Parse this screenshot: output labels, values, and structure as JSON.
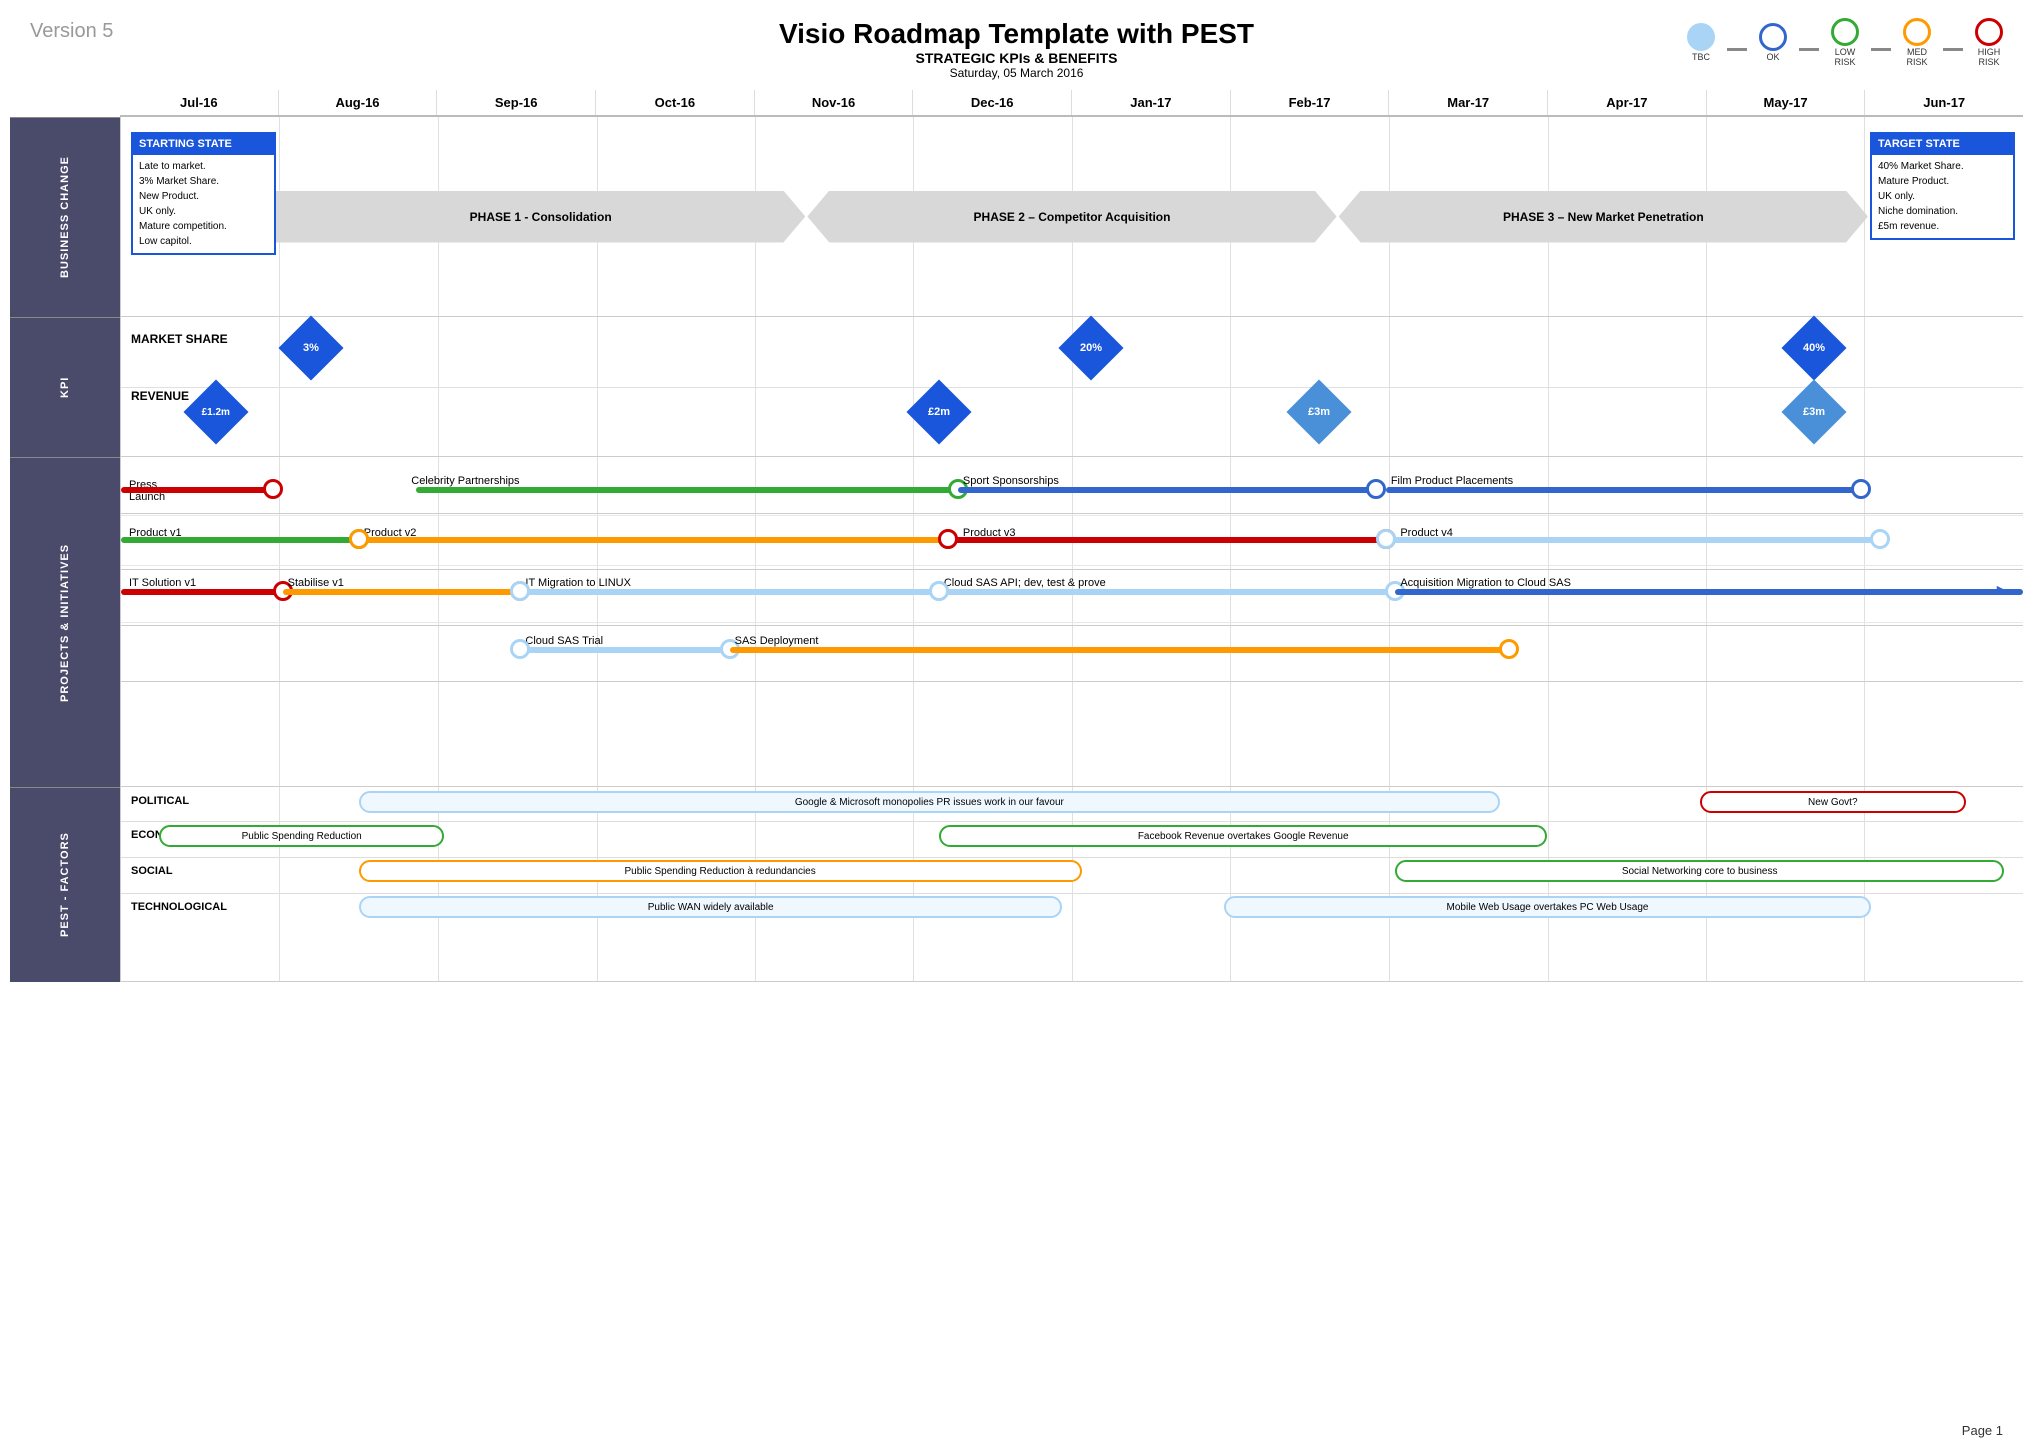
{
  "header": {
    "title": "Visio Roadmap Template with PEST",
    "subtitle": "STRATEGIC KPIs & BENEFITS",
    "date": "Saturday, 05 March 2016",
    "version": "Version 5"
  },
  "legend": {
    "items": [
      {
        "label": "TBC",
        "color": "#aad4f5",
        "border": "#aad4f5"
      },
      {
        "label": "OK",
        "color": "#fff",
        "border": "#3366cc"
      },
      {
        "label": "LOW\nRISK",
        "color": "#fff",
        "border": "#33aa33"
      },
      {
        "label": "MED\nRISK",
        "color": "#fff",
        "border": "#ff9900"
      },
      {
        "label": "HIGH\nRISK",
        "color": "#fff",
        "border": "#cc0000"
      }
    ]
  },
  "months": [
    "Jul-16",
    "Aug-16",
    "Sep-16",
    "Oct-16",
    "Nov-16",
    "Dec-16",
    "Jan-17",
    "Feb-17",
    "Mar-17",
    "Apr-17",
    "May-17",
    "Jun-17"
  ],
  "sections": {
    "business_change": {
      "label": "BUSINESS CHANGE",
      "starting_state": {
        "title": "STARTING STATE",
        "lines": [
          "Late to market.",
          "3% Market Share.",
          "New Product.",
          "UK only.",
          "Mature competition.",
          "Low capitol."
        ]
      },
      "target_state": {
        "title": "TARGET STATE",
        "lines": [
          "40% Market Share.",
          "Mature Product.",
          "UK only.",
          "Niche domination.",
          "£5m revenue."
        ]
      },
      "phases": [
        {
          "label": "PHASE 1 - Consolidation",
          "start": 0.08,
          "end": 0.38
        },
        {
          "label": "PHASE 2 – Competitor Acquisition",
          "start": 0.38,
          "end": 0.65
        },
        {
          "label": "PHASE 3 – New Market Penetration",
          "start": 0.65,
          "end": 0.92
        }
      ]
    },
    "kpi": {
      "label": "KPI",
      "rows": [
        {
          "label": "MARKET SHARE",
          "y_pct": 28,
          "diamonds": [
            {
              "pos": 0.1,
              "value": "3%"
            },
            {
              "pos": 0.51,
              "value": "20%"
            },
            {
              "pos": 0.89,
              "value": "40%"
            }
          ]
        },
        {
          "label": "REVENUE",
          "y_pct": 72,
          "diamonds": [
            {
              "pos": 0.06,
              "value": "£1.2m"
            },
            {
              "pos": 0.43,
              "value": "£2m"
            },
            {
              "pos": 0.64,
              "value": "£3m"
            },
            {
              "pos": 0.89,
              "value": "£3m"
            }
          ]
        }
      ]
    },
    "projects": {
      "label": "PROJECTS & INITIATIVES",
      "rows": [
        {
          "label": "Press Launch",
          "items": [
            {
              "type": "bar",
              "color": "#cc0000",
              "start": 0.0,
              "end": 0.085,
              "end_dot": {
                "color": "#cc0000",
                "side": "end"
              }
            }
          ]
        },
        {
          "label": "Celebrity Partnerships",
          "items": [
            {
              "type": "bar",
              "color": "#33aa33",
              "start": 0.155,
              "end": 0.44,
              "end_dot": {
                "color": "#33aa33",
                "side": "end"
              }
            }
          ]
        },
        {
          "label": "Sport Sponsorships",
          "items": [
            {
              "type": "bar",
              "color": "#3366cc",
              "start": 0.44,
              "end": 0.66,
              "end_dot": {
                "color": "#3366cc",
                "side": "end"
              }
            }
          ]
        },
        {
          "label": "Film Product Placements",
          "items": [
            {
              "type": "bar",
              "color": "#3366cc",
              "start": 0.665,
              "end": 0.91,
              "end_dot": {
                "color": "#3366cc",
                "side": "end"
              }
            }
          ]
        },
        {
          "label": "Product v1",
          "items": [
            {
              "type": "bar",
              "color": "#33aa33",
              "start": 0.0,
              "end": 0.125,
              "end_dot": {
                "color": "#33aa33",
                "side": "end"
              }
            }
          ]
        },
        {
          "label": "Product v2",
          "items": [
            {
              "type": "bar",
              "color": "#ff9900",
              "start": 0.125,
              "end": 0.44,
              "start_dot": {
                "color": "#ff9900"
              },
              "end_dot": {
                "color": "#ff9900",
                "side": "end"
              }
            }
          ]
        },
        {
          "label": "Product v3",
          "items": [
            {
              "type": "bar",
              "color": "#cc0000",
              "start": 0.44,
              "end": 0.665,
              "start_dot": {
                "color": "#cc0000"
              },
              "end_dot": {
                "color": "#cc0000",
                "side": "end"
              }
            }
          ]
        },
        {
          "label": "Product v4",
          "items": [
            {
              "type": "bar",
              "color": "#aad4f5",
              "start": 0.665,
              "end": 0.92,
              "start_dot": {
                "color": "#aad4f5"
              }
            }
          ]
        },
        {
          "label": "IT Solution v1 / Stabilise v1",
          "items": [
            {
              "type": "bar",
              "color": "#cc0000",
              "start": 0.0,
              "end": 0.085
            },
            {
              "type": "bar",
              "color": "#ff9900",
              "start": 0.085,
              "end": 0.21,
              "end_dot": {
                "color": "#ff9900",
                "side": "end"
              }
            }
          ]
        },
        {
          "label": "IT Migration / Cloud SAS API / Acquisition Migration",
          "items": [
            {
              "type": "bar",
              "color": "#aad4f5",
              "start": 0.21,
              "end": 0.44
            },
            {
              "type": "bar",
              "color": "#aad4f5",
              "start": 0.44,
              "end": 0.665
            },
            {
              "type": "arrow_bar",
              "color": "#3366cc",
              "start": 0.665,
              "end": 0.99
            }
          ]
        },
        {
          "label": "Cloud SAS Trial / SAS Deployment",
          "items": [
            {
              "type": "bar",
              "color": "#aad4f5",
              "start": 0.21,
              "end": 0.335
            },
            {
              "type": "bar",
              "color": "#ff9900",
              "start": 0.335,
              "end": 0.73,
              "end_dot": {
                "color": "#ff9900",
                "side": "end"
              }
            }
          ]
        }
      ]
    },
    "pest": {
      "label": "PEST - FACTORS",
      "rows": [
        {
          "label": "POLITICAL",
          "bars": [
            {
              "start": 0.125,
              "end": 0.73,
              "text": "Google & Microsoft monopolies PR issues work in our favour",
              "border": "#aad4f5",
              "bg": "#f0f8ff"
            },
            {
              "start": 0.84,
              "end": 0.97,
              "text": "New Govt?",
              "border": "#cc0000",
              "bg": "#fff"
            }
          ]
        },
        {
          "label": "ECONOMICAL",
          "bars": [
            {
              "start": 0.02,
              "end": 0.175,
              "text": "Public Spending Reduction",
              "border": "#33aa33",
              "bg": "#fff"
            },
            {
              "start": 0.44,
              "end": 0.75,
              "text": "Facebook Revenue overtakes Google Revenue",
              "border": "#33aa33",
              "bg": "#fff"
            }
          ]
        },
        {
          "label": "SOCIAL",
          "bars": [
            {
              "start": 0.125,
              "end": 0.5,
              "text": "Public Spending Reduction à redundancies",
              "border": "#ff9900",
              "bg": "#fff"
            },
            {
              "start": 0.68,
              "end": 0.99,
              "text": "Social Networking core to business",
              "border": "#33aa33",
              "bg": "#fff"
            }
          ]
        },
        {
          "label": "TECHNOLOGICAL",
          "bars": [
            {
              "start": 0.125,
              "end": 0.5,
              "text": "Public WAN widely available",
              "border": "#aad4f5",
              "bg": "#f0f8ff"
            },
            {
              "start": 0.59,
              "end": 0.92,
              "text": "Mobile Web Usage overtakes PC Web Usage",
              "border": "#aad4f5",
              "bg": "#f0f8ff"
            }
          ]
        }
      ]
    }
  },
  "page": {
    "number": "Page 1"
  }
}
